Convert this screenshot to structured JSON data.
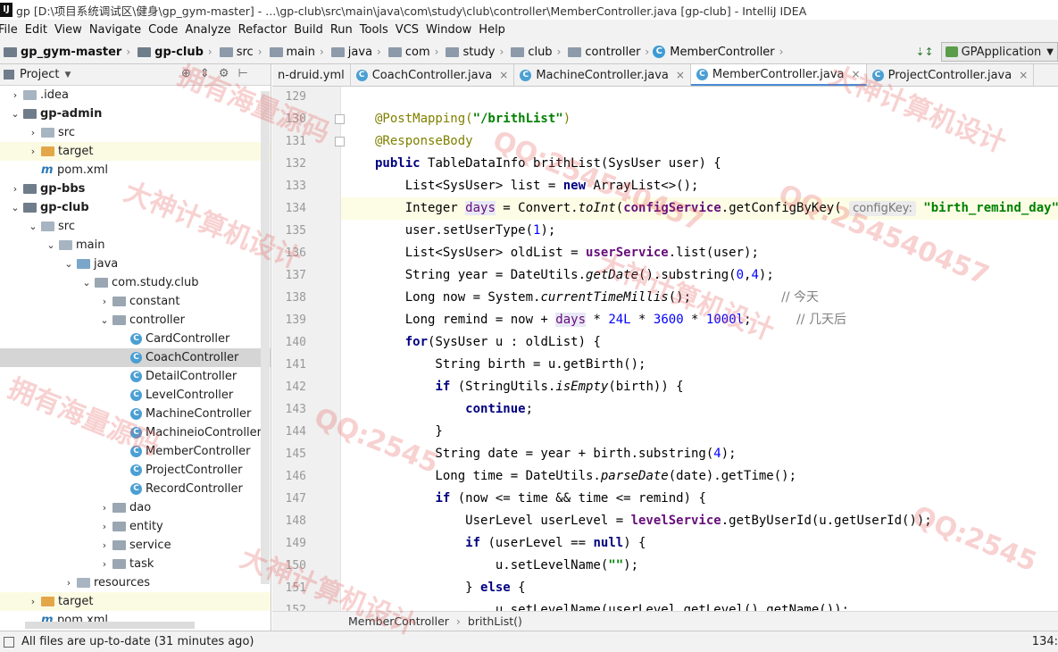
{
  "window": {
    "title": "gp [D:\\项目系统调试区\\健身\\gp_gym-master] - ...\\gp-club\\src\\main\\java\\com\\study\\club\\controller\\MemberController.java [gp-club] - IntelliJ IDEA",
    "app_icon": "IJ"
  },
  "menu": [
    "File",
    "Edit",
    "View",
    "Navigate",
    "Code",
    "Analyze",
    "Refactor",
    "Build",
    "Run",
    "Tools",
    "VCS",
    "Window",
    "Help"
  ],
  "navbar": {
    "crumbs": [
      "gp_gym-master",
      "gp-club",
      "src",
      "main",
      "java",
      "com",
      "study",
      "club",
      "controller",
      "MemberController"
    ],
    "run_config": "GPApplication"
  },
  "project_panel": {
    "title": "Project",
    "tree": [
      {
        "label": ".idea",
        "depth": 1,
        "arrow": "▶",
        "icon": "folder"
      },
      {
        "label": "gp-admin",
        "depth": 1,
        "arrow": "▼",
        "icon": "module",
        "bold": true
      },
      {
        "label": "src",
        "depth": 2,
        "arrow": "▶",
        "icon": "folder"
      },
      {
        "label": "target",
        "depth": 2,
        "arrow": "▶",
        "icon": "target",
        "highlight": true
      },
      {
        "label": "pom.xml",
        "depth": 2,
        "arrow": "",
        "icon": "maven"
      },
      {
        "label": "gp-bbs",
        "depth": 1,
        "arrow": "▶",
        "icon": "module",
        "bold": true
      },
      {
        "label": "gp-club",
        "depth": 1,
        "arrow": "▼",
        "icon": "module",
        "bold": true
      },
      {
        "label": "src",
        "depth": 2,
        "arrow": "▼",
        "icon": "folder"
      },
      {
        "label": "main",
        "depth": 3,
        "arrow": "▼",
        "icon": "folder"
      },
      {
        "label": "java",
        "depth": 4,
        "arrow": "▼",
        "icon": "src"
      },
      {
        "label": "com.study.club",
        "depth": 5,
        "arrow": "▼",
        "icon": "package"
      },
      {
        "label": "constant",
        "depth": 6,
        "arrow": "▶",
        "icon": "package"
      },
      {
        "label": "controller",
        "depth": 6,
        "arrow": "▼",
        "icon": "package"
      },
      {
        "label": "CardController",
        "depth": 7,
        "arrow": "",
        "icon": "class"
      },
      {
        "label": "CoachController",
        "depth": 7,
        "arrow": "",
        "icon": "class",
        "selected": true
      },
      {
        "label": "DetailController",
        "depth": 7,
        "arrow": "",
        "icon": "class"
      },
      {
        "label": "LevelController",
        "depth": 7,
        "arrow": "",
        "icon": "class"
      },
      {
        "label": "MachineController",
        "depth": 7,
        "arrow": "",
        "icon": "class"
      },
      {
        "label": "MachineioController",
        "depth": 7,
        "arrow": "",
        "icon": "class"
      },
      {
        "label": "MemberController",
        "depth": 7,
        "arrow": "",
        "icon": "class"
      },
      {
        "label": "ProjectController",
        "depth": 7,
        "arrow": "",
        "icon": "class"
      },
      {
        "label": "RecordController",
        "depth": 7,
        "arrow": "",
        "icon": "class"
      },
      {
        "label": "dao",
        "depth": 6,
        "arrow": "▶",
        "icon": "package"
      },
      {
        "label": "entity",
        "depth": 6,
        "arrow": "▶",
        "icon": "package"
      },
      {
        "label": "service",
        "depth": 6,
        "arrow": "▶",
        "icon": "package"
      },
      {
        "label": "task",
        "depth": 6,
        "arrow": "▶",
        "icon": "package"
      },
      {
        "label": "resources",
        "depth": 4,
        "arrow": "▶",
        "icon": "resources"
      },
      {
        "label": "target",
        "depth": 2,
        "arrow": "▶",
        "icon": "target",
        "highlight": true
      },
      {
        "label": "pom.xml",
        "depth": 2,
        "arrow": "",
        "icon": "maven"
      }
    ]
  },
  "tabs": [
    {
      "label": "n-druid.yml",
      "icon": "",
      "active": false
    },
    {
      "label": "CoachController.java",
      "icon": "class",
      "active": false
    },
    {
      "label": "MachineController.java",
      "icon": "class",
      "active": false
    },
    {
      "label": "MemberController.java",
      "icon": "class",
      "active": true
    },
    {
      "label": "ProjectController.java",
      "icon": "class",
      "active": false
    }
  ],
  "editor": {
    "first_line": 129,
    "current_line": 134,
    "lines": [
      [],
      [
        {
          "t": "@PostMapping(",
          "c": "ann"
        },
        {
          "t": "\"/brithList\"",
          "c": "str"
        },
        {
          "t": ")",
          "c": "ann"
        }
      ],
      [
        {
          "t": "@ResponseBody",
          "c": "ann"
        }
      ],
      [
        {
          "t": "public ",
          "c": "kw"
        },
        {
          "t": "TableDataInfo brithList(SysUser user) {"
        }
      ],
      [
        {
          "t": "    List<SysUser> list = "
        },
        {
          "t": "new ",
          "c": "kw"
        },
        {
          "t": "ArrayList<>();"
        }
      ],
      [
        {
          "t": "    Integer "
        },
        {
          "t": "days",
          "c": "var"
        },
        {
          "t": " = Convert."
        },
        {
          "t": "toInt",
          "c": "sfn"
        },
        {
          "t": "("
        },
        {
          "t": "configService",
          "c": "fld"
        },
        {
          "t": ".getConfigByKey( "
        },
        {
          "t": "configKey:",
          "c": "hint"
        },
        {
          "t": " "
        },
        {
          "t": "\"birth_remind_day\"",
          "c": "str"
        },
        {
          "t": "));"
        }
      ],
      [
        {
          "t": "    user.setUserType("
        },
        {
          "t": "1",
          "c": "num"
        },
        {
          "t": ");"
        }
      ],
      [
        {
          "t": "    List<SysUser> oldList = "
        },
        {
          "t": "userService",
          "c": "fld"
        },
        {
          "t": ".list(user);"
        }
      ],
      [
        {
          "t": "    String year = DateUtils."
        },
        {
          "t": "getDate",
          "c": "sfn"
        },
        {
          "t": "().substring("
        },
        {
          "t": "0",
          "c": "num"
        },
        {
          "t": ","
        },
        {
          "t": "4",
          "c": "num"
        },
        {
          "t": ");"
        }
      ],
      [
        {
          "t": "    Long now = System."
        },
        {
          "t": "currentTimeMillis",
          "c": "sfn"
        },
        {
          "t": "();            "
        },
        {
          "t": "// 今天",
          "c": "cmt"
        }
      ],
      [
        {
          "t": "    Long remind = now + "
        },
        {
          "t": "days",
          "c": "var"
        },
        {
          "t": " * "
        },
        {
          "t": "24L",
          "c": "num"
        },
        {
          "t": " * "
        },
        {
          "t": "3600",
          "c": "num"
        },
        {
          "t": " * "
        },
        {
          "t": "1000l",
          "c": "num"
        },
        {
          "t": ";      "
        },
        {
          "t": "// 几天后",
          "c": "cmt"
        }
      ],
      [
        {
          "t": "    "
        },
        {
          "t": "for",
          "c": "kw"
        },
        {
          "t": "(SysUser u : oldList) {"
        }
      ],
      [
        {
          "t": "        String birth = u.getBirth();"
        }
      ],
      [
        {
          "t": "        "
        },
        {
          "t": "if ",
          "c": "kw"
        },
        {
          "t": "(StringUtils."
        },
        {
          "t": "isEmpty",
          "c": "sfn"
        },
        {
          "t": "(birth)) {"
        }
      ],
      [
        {
          "t": "            "
        },
        {
          "t": "continue",
          "c": "kw"
        },
        {
          "t": ";"
        }
      ],
      [
        {
          "t": "        }"
        }
      ],
      [
        {
          "t": "        String date = year + birth.substring("
        },
        {
          "t": "4",
          "c": "num"
        },
        {
          "t": ");"
        }
      ],
      [
        {
          "t": "        Long time = DateUtils."
        },
        {
          "t": "parseDate",
          "c": "sfn"
        },
        {
          "t": "(date).getTime();"
        }
      ],
      [
        {
          "t": "        "
        },
        {
          "t": "if ",
          "c": "kw"
        },
        {
          "t": "(now <= time && time <= remind) {"
        }
      ],
      [
        {
          "t": "            UserLevel userLevel = "
        },
        {
          "t": "levelService",
          "c": "fld"
        },
        {
          "t": ".getByUserId(u.getUserId());"
        }
      ],
      [
        {
          "t": "            "
        },
        {
          "t": "if ",
          "c": "kw"
        },
        {
          "t": "(userLevel == "
        },
        {
          "t": "null",
          "c": "kw"
        },
        {
          "t": ") {"
        }
      ],
      [
        {
          "t": "                u.setLevelName("
        },
        {
          "t": "\"\"",
          "c": "str"
        },
        {
          "t": ");"
        }
      ],
      [
        {
          "t": "            } "
        },
        {
          "t": "else ",
          "c": "kw"
        },
        {
          "t": "{"
        }
      ],
      [
        {
          "t": "                u.setLevelName(userLevel.getLevel().getName());"
        }
      ]
    ]
  },
  "editor_crumbs": [
    "MemberController",
    "brithList()"
  ],
  "status": {
    "message": "All files are up-to-date (31 minutes ago)",
    "position": "134:"
  },
  "watermarks": [
    "拥有海量源码",
    "QQ:254540457",
    "大神计算机设计",
    "大神计算机设计",
    "QQ:2545"
  ],
  "colors": {
    "accent": "#4b8bd6",
    "keyword": "#000080",
    "string": "#008000",
    "annotation": "#808000",
    "number": "#0000ff",
    "field": "#660e7a",
    "selection": "#d5d5d5",
    "current_line": "#fdfde6"
  }
}
